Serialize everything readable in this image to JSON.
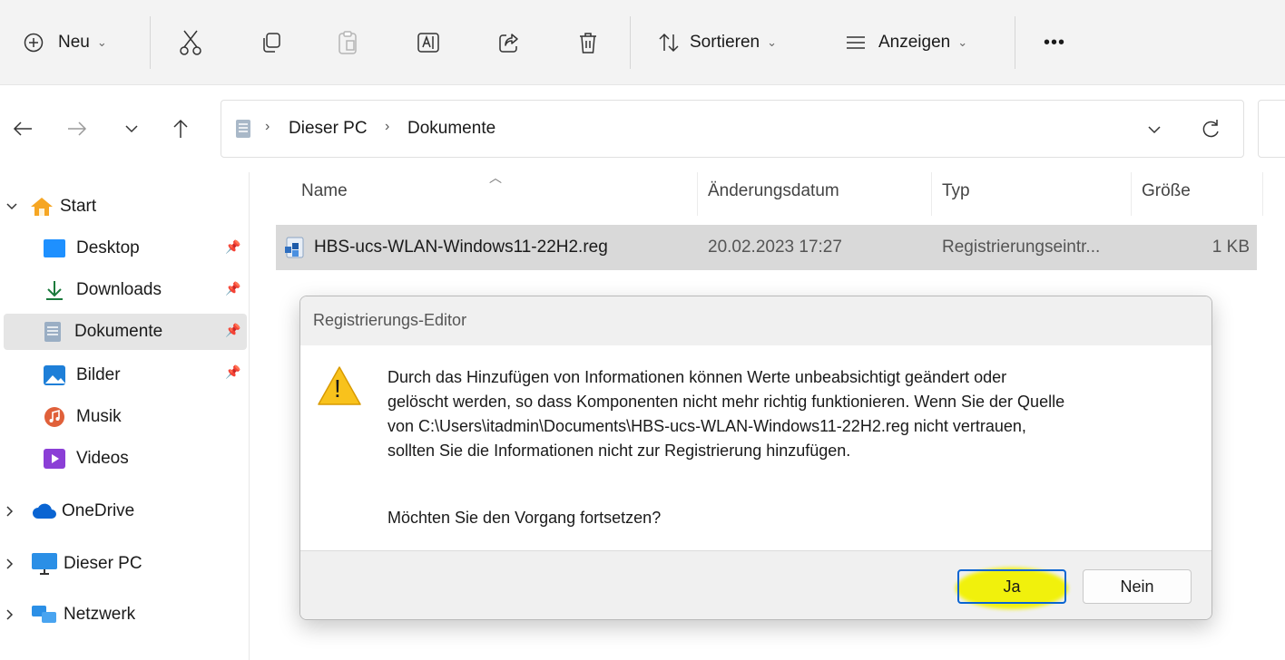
{
  "toolbar": {
    "new_label": "Neu",
    "sort_label": "Sortieren",
    "view_label": "Anzeigen",
    "more_label": "•••"
  },
  "address": {
    "path": [
      "Dieser PC",
      "Dokumente"
    ]
  },
  "sidebar": {
    "start": "Start",
    "items": [
      {
        "label": "Desktop",
        "pinned": true
      },
      {
        "label": "Downloads",
        "pinned": true
      },
      {
        "label": "Dokumente",
        "pinned": true,
        "selected": true
      },
      {
        "label": "Bilder",
        "pinned": true
      },
      {
        "label": "Musik",
        "pinned": false
      },
      {
        "label": "Videos",
        "pinned": false
      }
    ],
    "groups": [
      "OneDrive",
      "Dieser PC",
      "Netzwerk"
    ]
  },
  "columns": {
    "name": "Name",
    "date": "Änderungsdatum",
    "type": "Typ",
    "size": "Größe"
  },
  "files": [
    {
      "name": "HBS-ucs-WLAN-Windows11-22H2.reg",
      "date": "20.02.2023 17:27",
      "type": "Registrierungseintr...",
      "size": "1 KB"
    }
  ],
  "dialog": {
    "title": "Registrierungs-Editor",
    "message_lines": [
      "Durch das Hinzufügen von Informationen können Werte unbeabsichtigt geändert oder",
      "gelöscht werden, so dass Komponenten nicht mehr richtig funktionieren. Wenn Sie der Quelle",
      "von C:\\Users\\itadmin\\Documents\\HBS-ucs-WLAN-Windows11-22H2.reg nicht vertrauen,",
      "sollten Sie die Informationen nicht zur Registrierung hinzufügen."
    ],
    "question": "Möchten Sie den Vorgang fortsetzen?",
    "yes_label": "Ja",
    "no_label": "Nein",
    "warning_icon_text": "!"
  },
  "colors": {
    "highlight": "#f2f200",
    "warning": "#f8c21c",
    "accent": "#0a64d2"
  }
}
